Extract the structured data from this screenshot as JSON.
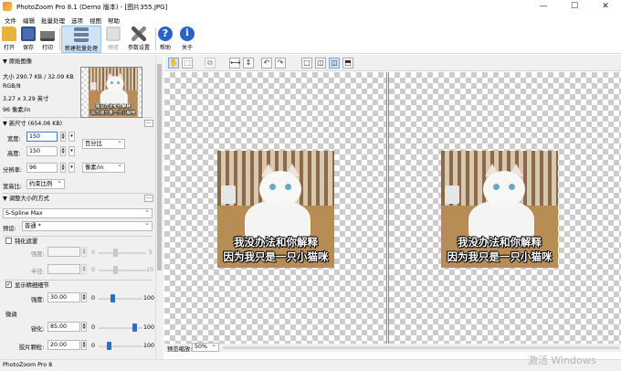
{
  "window": {
    "title": "PhotoZoom Pro 8.1 (Demo 版本) - [图片355.JPG]",
    "minimize_glyph": "—",
    "maximize_glyph": "☐",
    "close_glyph": "✕"
  },
  "menu": [
    "文件",
    "编辑",
    "批量处理",
    "选项",
    "视图",
    "帮助"
  ],
  "toolbar": [
    {
      "label": "打开",
      "icon": "folder-open-icon",
      "color": "#e8b33a"
    },
    {
      "label": "保存",
      "icon": "save-icon",
      "color": "#4a6fb0"
    },
    {
      "label": "打印",
      "icon": "printer-icon",
      "color": "#555555"
    },
    {
      "label": "新建批量处理",
      "icon": "batch-stack-icon",
      "color": "#6a7fa0"
    },
    {
      "label": "预览",
      "icon": "preview-icon",
      "color": "#999999"
    },
    {
      "label": "参数设置",
      "icon": "tools-icon",
      "color": "#555555"
    },
    {
      "label": "帮助",
      "icon": "help-icon",
      "color": "#2a63c8"
    },
    {
      "label": "关于",
      "icon": "info-icon",
      "color": "#2a63c8"
    }
  ],
  "original": {
    "header": "▼ 原始图像",
    "size": "大小 290.7 KB / 32.09 KB",
    "mode": "RGB/8",
    "dimensions": "3.27 x 3.29 英寸",
    "resolution": "96 像素/in"
  },
  "newsize": {
    "header": "▼ 新尺寸 (654.06 KB)",
    "width_label": "宽度:",
    "width_value": "150",
    "height_label": "高度:",
    "height_value": "150",
    "res_label": "分辨率:",
    "res_value": "96",
    "unit_percent": "百分比",
    "unit_res": "像素/in",
    "aspect_label": "宽高比:",
    "aspect_value": "约束比例"
  },
  "resize": {
    "header": "▼ 调整大小的方式",
    "method": "S-Spline Max",
    "preset_label": "预设:",
    "preset_value": "普通 *",
    "unsharp_label": "钝化遮罩",
    "strength_label": "强度:",
    "radius_label": "半径:",
    "min0": "0",
    "max5": "5",
    "max10": "10",
    "fine_label": "显示精细细节",
    "fine_strength_value": "30.00",
    "max100": "100",
    "tweak_header": "微调",
    "sharpen_label": "锐化:",
    "sharpen_value": "85.00",
    "film_label": "胶片颗粒:",
    "film_value": "20.00"
  },
  "controls": {
    "sliders": {
      "unsharp_strength": 0.35,
      "unsharp_radius": 0.35,
      "fine_detail": 0.3,
      "sharpen": 0.85,
      "film_grain": 0.2
    }
  },
  "preview": {
    "caption_line1": "我没办法和你解释",
    "caption_line2": "因为我只是一只小猫咪",
    "zoom_label": "预览缩放:",
    "zoom_value": "50%"
  },
  "status": {
    "text": "PhotoZoom Pro 8"
  },
  "watermark": "激活 Windows",
  "subtools": [
    {
      "name": "hand-tool-icon",
      "glyph": "✋"
    },
    {
      "name": "marquee-tool-icon",
      "glyph": "⬚"
    },
    {
      "name": "crop-tool-icon",
      "glyph": "⧉"
    },
    {
      "name": "flip-horizontal-icon",
      "glyph": "⟷"
    },
    {
      "name": "flip-vertical-icon",
      "glyph": "↕"
    },
    {
      "name": "rotate-left-icon",
      "glyph": "↶"
    },
    {
      "name": "rotate-right-icon",
      "glyph": "↷"
    },
    {
      "name": "view-single-icon",
      "glyph": "□"
    },
    {
      "name": "view-split-vertical-icon",
      "glyph": "◫"
    },
    {
      "name": "view-side-by-side-icon",
      "glyph": "◫"
    },
    {
      "name": "view-split-horizontal-icon",
      "glyph": "⬒"
    }
  ]
}
